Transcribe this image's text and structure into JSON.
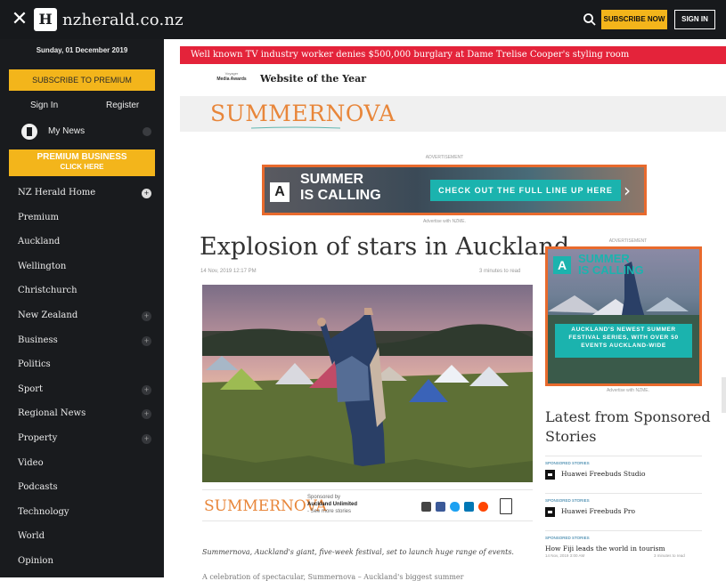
{
  "topbar": {
    "close_icon": "close-icon",
    "logo_mark": "H",
    "site_name": "nzherald.co.nz",
    "search_icon": "search-icon",
    "subscribe_label": "SUBSCRIBE NOW",
    "signin_label": "SIGN IN",
    "subscribe_color": "#f3b51b"
  },
  "sidebar": {
    "date": "Sunday, 01 December 2019",
    "premium_button": "SUBSCRIBE TO PREMIUM",
    "signin": "Sign In",
    "register": "Register",
    "mynews": "My News",
    "business_banner_line1": "PREMIUM BUSINESS",
    "business_banner_line2": "CLICK HERE",
    "nav": [
      {
        "label": "NZ Herald Home",
        "expand": true,
        "active": true
      },
      {
        "label": "Premium",
        "expand": false
      },
      {
        "label": "Auckland",
        "expand": false
      },
      {
        "label": "Wellington",
        "expand": false
      },
      {
        "label": "Christchurch",
        "expand": false
      },
      {
        "label": "New Zealand",
        "expand": true
      },
      {
        "label": "Business",
        "expand": true
      },
      {
        "label": "Politics",
        "expand": false
      },
      {
        "label": "Sport",
        "expand": true
      },
      {
        "label": "Regional News",
        "expand": true
      },
      {
        "label": "Property",
        "expand": true
      },
      {
        "label": "Video",
        "expand": false
      },
      {
        "label": "Podcasts",
        "expand": false
      },
      {
        "label": "Technology",
        "expand": false
      },
      {
        "label": "World",
        "expand": false
      },
      {
        "label": "Opinion",
        "expand": false
      }
    ]
  },
  "breaking": {
    "text": "Well known TV industry worker denies $500,000 burglary at Dame Trelise Cooper's styling room",
    "color": "#e4233a"
  },
  "award": {
    "logo_line1": "Voyager",
    "logo_line2": "Media Awards",
    "text": "Website of the Year"
  },
  "masthead": {
    "brand": "SUMMERNOVA",
    "brand_color": "#e8863a"
  },
  "top_ad": {
    "label": "ADVERTISEMENT",
    "mark": "A",
    "line1": "SUMMER",
    "line2": "IS CALLING",
    "cta": "CHECK OUT THE FULL LINE UP HERE",
    "chevron": "›",
    "footer": "Advertise with NZME."
  },
  "article": {
    "headline": "Explosion of stars in Auckland",
    "date": "14 Nov, 2019 12:17 PM",
    "read_time": "3 minutes to read",
    "sponsor_brand": "SUMMERNOVA",
    "sponsored_by": "Sponsored by",
    "sponsor_name": "Auckland Unlimited",
    "sponsor_more": "- See more stories",
    "share_icons": [
      "mail-icon",
      "facebook-icon",
      "twitter-icon",
      "linkedin-icon",
      "reddit-icon",
      "bookmark-icon"
    ],
    "lead": "Summernova, Auckland's giant, five-week festival, set to launch huge range of events.",
    "para2": "A celebration of spectacular, Summernova – Auckland's biggest summer"
  },
  "side_ad": {
    "label": "ADVERTISEMENT",
    "mark": "A",
    "line1": "SUMMER",
    "line2": "IS CALLING",
    "desc_line1": "AUCKLAND'S NEWEST SUMMER",
    "desc_line2": "FESTIVAL SERIES, WITH OVER 50",
    "desc_line3": "EVENTS AUCKLAND-WIDE",
    "footer": "Advertise with NZME."
  },
  "sponsored": {
    "heading": "Latest from Sponsored Stories",
    "stories": [
      {
        "kicker": "SPONSORED STORIES",
        "title": "Huawei Freebuds Studio",
        "thumb": true
      },
      {
        "kicker": "SPONSORED STORIES",
        "title": "Huawei Freebuds Pro",
        "thumb": true
      },
      {
        "kicker": "SPONSORED STORIES",
        "title": "How Fiji leads the world in tourism",
        "thumb": false,
        "meta": "14 Nov, 2019 3:00 AM",
        "read": "3 minutes to read"
      }
    ]
  }
}
